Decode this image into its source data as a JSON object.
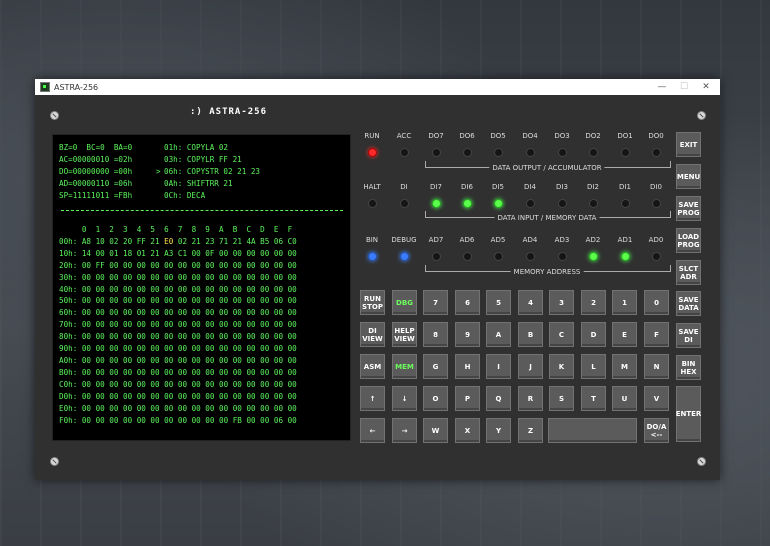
{
  "window": {
    "title": "ASTRA-256",
    "logo": ":) ASTRA-256",
    "minimize": "—",
    "maximize": "☐",
    "close": "✕"
  },
  "screen": {
    "registers": "BZ=0  BC=0  BA=0\nAC=00000010 =02h\nDO=00000000 =00h\nAD=00000110 =06h\nSP=11111011 =FBh",
    "pointer": "\n\n>",
    "asm": "01h: COPYLA 02\n03h: COPYLR FF 21\n06h: COPYSTR 02 21 23\n0Ah: SHIFTRR 21\n0Ch: DECA",
    "dump_header": "     0  1  2  3  4  5  6  7  8  9  A  B  C  D  E  F",
    "dump_row0_a": "00h: A8 10 02 20 FF 21 ",
    "dump_row0_hl": "E0",
    "dump_row0_b": " 02 21 23 71 21 4A B5 06 C0",
    "dump_rest": "10h: 14 00 01 18 01 21 A3 C1 00 0F 00 00 00 00 00 00\n20h: 00 FF 00 00 00 00 00 00 00 00 00 00 00 00 00 00\n30h: 00 00 00 00 00 00 00 00 00 00 00 00 00 00 00 00\n40h: 00 00 00 00 00 00 00 00 00 00 00 00 00 00 00 00\n50h: 00 00 00 00 00 00 00 00 00 00 00 00 00 00 00 00\n60h: 00 00 00 00 00 00 00 00 00 00 00 00 00 00 00 00\n70h: 00 00 00 00 00 00 00 00 00 00 00 00 00 00 00 00\n80h: 00 00 00 00 00 00 00 00 00 00 00 00 00 00 00 00\n90h: 00 00 00 00 00 00 00 00 00 00 00 00 00 00 00 00\nA0h: 00 00 00 00 00 00 00 00 00 00 00 00 00 00 00 00\nB0h: 00 00 00 00 00 00 00 00 00 00 00 00 00 00 00 00\nC0h: 00 00 00 00 00 00 00 00 00 00 00 00 00 00 00 00\nD0h: 00 00 00 00 00 00 00 00 00 00 00 00 00 00 00 00\nE0h: 00 00 00 00 00 00 00 00 00 00 00 00 00 00 00 00\nF0h: 00 00 00 00 00 00 00 00 00 00 00 FB 00 00 06 00"
  },
  "leds": {
    "row1": {
      "labels": [
        "RUN",
        "ACC",
        "DO7",
        "DO6",
        "DO5",
        "DO4",
        "DO3",
        "DO2",
        "DO1",
        "DO0"
      ],
      "states": [
        "red",
        "off",
        "off",
        "off",
        "off",
        "off",
        "off",
        "off",
        "off",
        "off"
      ],
      "caption": "DATA OUTPUT / ACCUMULATOR"
    },
    "row2": {
      "labels": [
        "HALT",
        "DI",
        "DI7",
        "DI6",
        "DI5",
        "DI4",
        "DI3",
        "DI2",
        "DI1",
        "DI0"
      ],
      "states": [
        "off",
        "off",
        "green",
        "green",
        "green",
        "off",
        "off",
        "off",
        "off",
        "off"
      ],
      "caption": "DATA INPUT  / MEMORY DATA"
    },
    "row3": {
      "labels": [
        "BIN",
        "DEBUG",
        "AD7",
        "AD6",
        "AD5",
        "AD4",
        "AD3",
        "AD2",
        "AD1",
        "AD0"
      ],
      "states": [
        "blue",
        "blue",
        "off",
        "off",
        "off",
        "off",
        "off",
        "green",
        "green",
        "off"
      ],
      "caption": "MEMORY ADDRESS"
    }
  },
  "keypad": {
    "rows": [
      [
        "RUN\nSTOP",
        "DBG",
        "7",
        "6",
        "5",
        "4",
        "3",
        "2",
        "1",
        "0"
      ],
      [
        "DI\nVIEW",
        "HELP\nVIEW",
        "8",
        "9",
        "A",
        "B",
        "C",
        "D",
        "E",
        "F"
      ],
      [
        "ASM",
        "MEM",
        "G",
        "H",
        "I",
        "J",
        "K",
        "L",
        "M",
        "N"
      ],
      [
        "↑",
        "↓",
        "O",
        "P",
        "Q",
        "R",
        "S",
        "T",
        "U",
        "V"
      ],
      [
        "←",
        "→",
        "W",
        "X",
        "Y",
        "Z",
        "",
        "DO/A\n<--"
      ]
    ],
    "green": [
      "DBG",
      "MEM"
    ]
  },
  "side": [
    "EXIT",
    "MENU",
    "SAVE\nPROG",
    "LOAD\nPROG",
    "SLCT\nADR",
    "SAVE\nDATA",
    "SAVE\nDI",
    "BIN\nHEX",
    "ENTER"
  ]
}
